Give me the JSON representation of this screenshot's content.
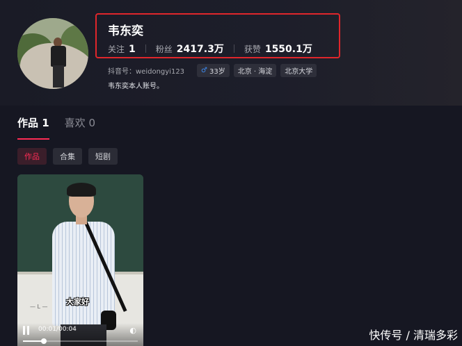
{
  "profile": {
    "name": "韦东奕",
    "stats": [
      {
        "label": "关注",
        "value": "1"
      },
      {
        "label": "粉丝",
        "value": "2417.3万"
      },
      {
        "label": "获赞",
        "value": "1550.1万"
      }
    ],
    "douyin_id": "抖音号：weidongyi123",
    "tags": {
      "age": "33岁",
      "location": "北京 · 海淀",
      "school": "北京大学"
    },
    "bio": "韦东奕本人账号。",
    "highlight_color": "#e0262b"
  },
  "tabs": [
    {
      "label": "作品 1",
      "active": true
    },
    {
      "label": "喜欢 0",
      "active": false
    }
  ],
  "subtabs": [
    {
      "label": "作品",
      "active": true
    },
    {
      "label": "合集",
      "active": false
    },
    {
      "label": "短剧",
      "active": false
    }
  ],
  "video": {
    "subtitle": "大家好",
    "time": "00:01/00:04",
    "progress": 0.18,
    "chalk_text": "— L —"
  },
  "watermark": "快传号 / 清瑞多彩",
  "colors": {
    "accent": "#fe2c55",
    "background": "#161722"
  }
}
